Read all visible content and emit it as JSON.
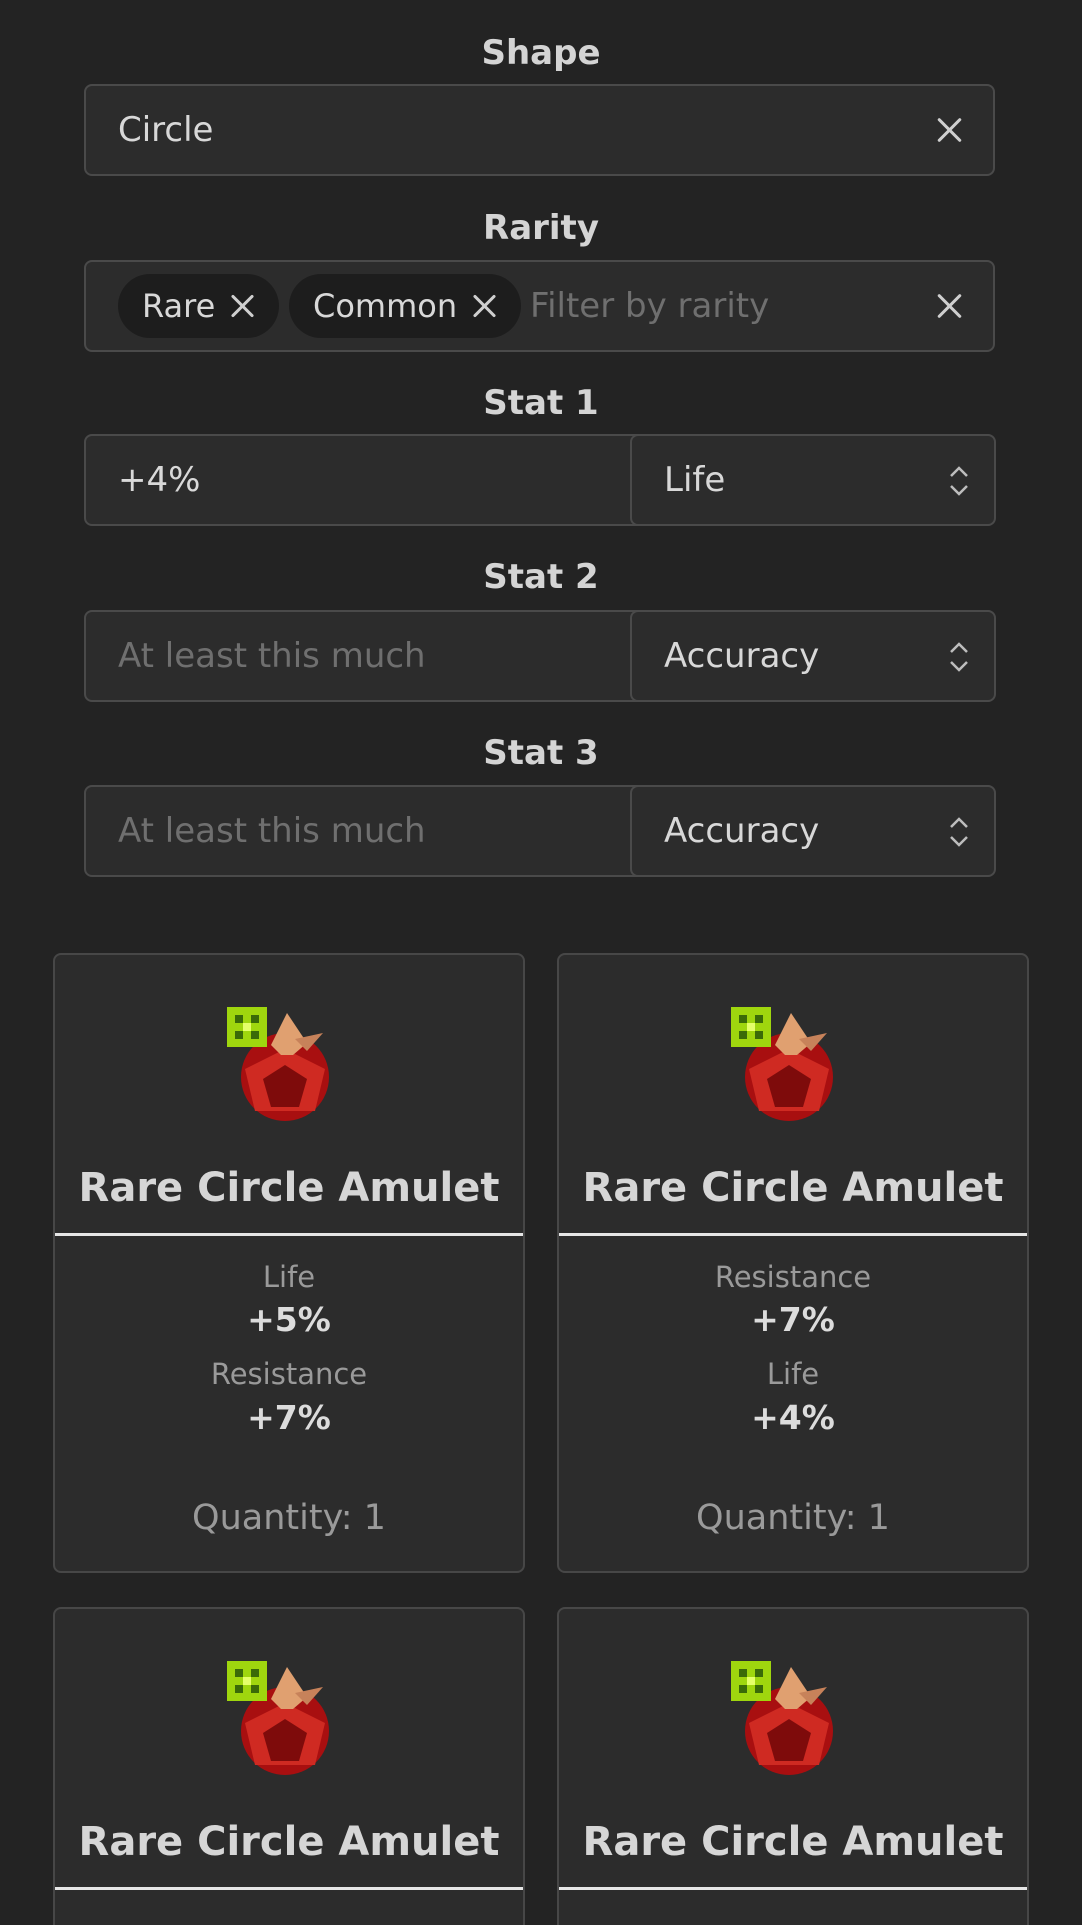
{
  "filters": {
    "shape": {
      "label": "Shape",
      "value": "Circle"
    },
    "rarity": {
      "label": "Rarity",
      "tags": [
        "Rare",
        "Common"
      ],
      "placeholder": "Filter by rarity"
    },
    "stats": [
      {
        "label": "Stat 1",
        "value": "+4%",
        "placeholder": "",
        "type": "Life"
      },
      {
        "label": "Stat 2",
        "value": "",
        "placeholder": "At least this much",
        "type": "Accuracy"
      },
      {
        "label": "Stat 3",
        "value": "",
        "placeholder": "At least this much",
        "type": "Accuracy"
      }
    ]
  },
  "items": [
    {
      "title": "Rare Circle Amulet",
      "stats": [
        {
          "name": "Life",
          "value": "+5%"
        },
        {
          "name": "Resistance",
          "value": "+7%"
        }
      ],
      "quantity": "Quantity: 1",
      "icon": "red-amulet-icon"
    },
    {
      "title": "Rare Circle Amulet",
      "stats": [
        {
          "name": "Resistance",
          "value": "+7%"
        },
        {
          "name": "Life",
          "value": "+4%"
        }
      ],
      "quantity": "Quantity: 1",
      "icon": "red-amulet-icon"
    },
    {
      "title": "Rare Circle Amulet",
      "icon": "red-amulet-icon"
    },
    {
      "title": "Rare Circle Amulet",
      "icon": "red-amulet-icon"
    }
  ],
  "colors": {
    "background": "#232323",
    "panel": "#2c2c2c",
    "border": "#4a4a4a"
  }
}
